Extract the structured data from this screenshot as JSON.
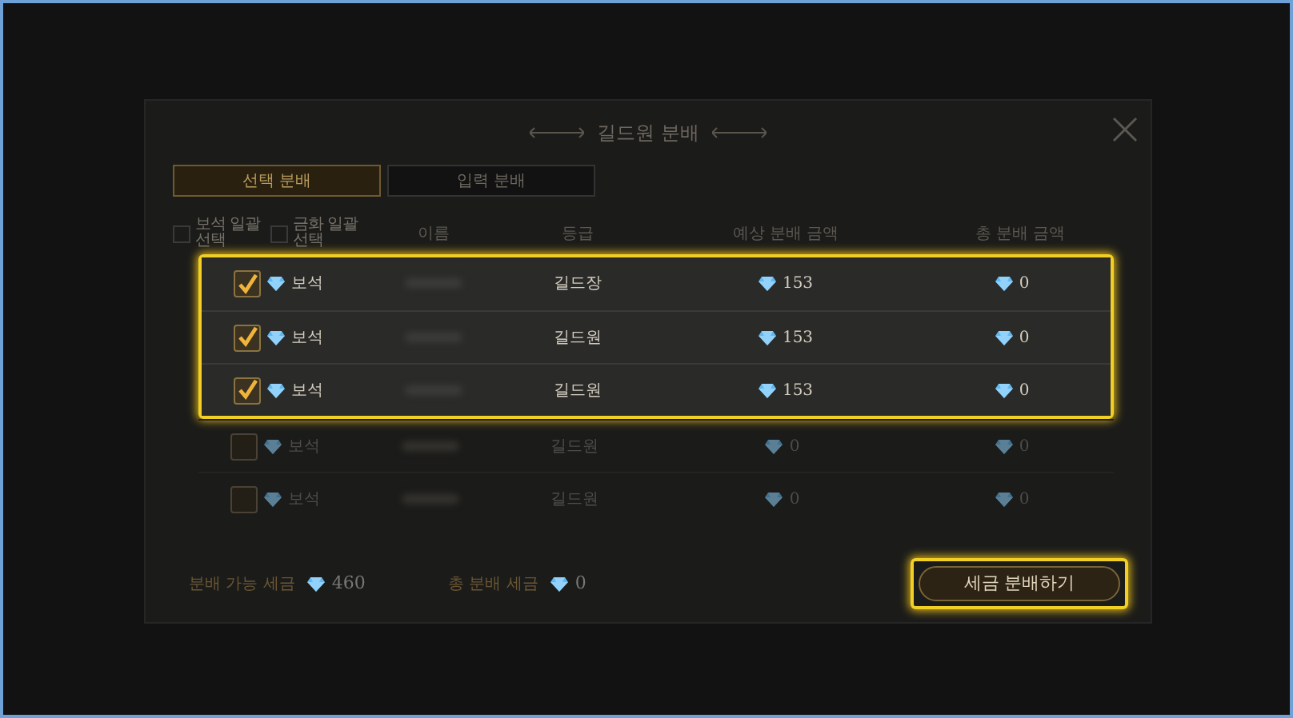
{
  "title": "길드원 분배",
  "tabs": [
    {
      "label": "선택 분배",
      "selected": true
    },
    {
      "label": "입력 분배",
      "selected": false
    }
  ],
  "bulk_select": [
    {
      "label": "보석 일괄 선택",
      "checked": false
    },
    {
      "label": "금화 일괄 선택",
      "checked": false
    }
  ],
  "columns": [
    "이름",
    "등급",
    "예상 분배 금액",
    "총 분배 금액"
  ],
  "rows": [
    {
      "checked": true,
      "highlighted": true,
      "currency": "보석",
      "grade": "길드장",
      "expected": "153",
      "total": "0"
    },
    {
      "checked": true,
      "highlighted": true,
      "currency": "보석",
      "grade": "길드원",
      "expected": "153",
      "total": "0"
    },
    {
      "checked": true,
      "highlighted": true,
      "currency": "보석",
      "grade": "길드원",
      "expected": "153",
      "total": "0"
    },
    {
      "checked": false,
      "highlighted": false,
      "currency": "보석",
      "grade": "길드원",
      "expected": "0",
      "total": "0"
    },
    {
      "checked": false,
      "highlighted": false,
      "currency": "보석",
      "grade": "길드원",
      "expected": "0",
      "total": "0"
    }
  ],
  "footer": {
    "available_label": "분배 가능 세금",
    "available_value": "460",
    "total_label": "총 분배 세금",
    "total_value": "0"
  },
  "button": {
    "label": "세금 분배하기",
    "highlighted": true
  }
}
